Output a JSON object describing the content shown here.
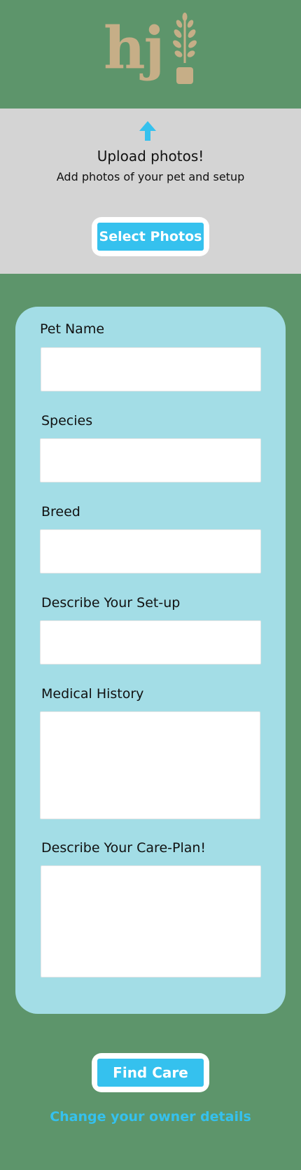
{
  "logo": {
    "text": "hj"
  },
  "upload": {
    "title": "Upload photos!",
    "subtitle": "Add photos of your pet and setup",
    "button_label": "Select Photos"
  },
  "form": {
    "fields": [
      {
        "label": "Pet Name",
        "value": ""
      },
      {
        "label": "Species",
        "value": ""
      },
      {
        "label": "Breed",
        "value": ""
      },
      {
        "label": "Describe Your Set-up",
        "value": ""
      },
      {
        "label": "Medical History",
        "value": ""
      },
      {
        "label": "Describe Your Care-Plan!",
        "value": ""
      }
    ]
  },
  "actions": {
    "find_care_label": "Find Care",
    "change_details_link": "Change your owner details"
  },
  "colors": {
    "page_green": "#5d956b",
    "upload_gray": "#d4d4d4",
    "card_blue": "#a3dde6",
    "accent_blue": "#35c1ee",
    "logo_tan": "#c6ae87"
  }
}
